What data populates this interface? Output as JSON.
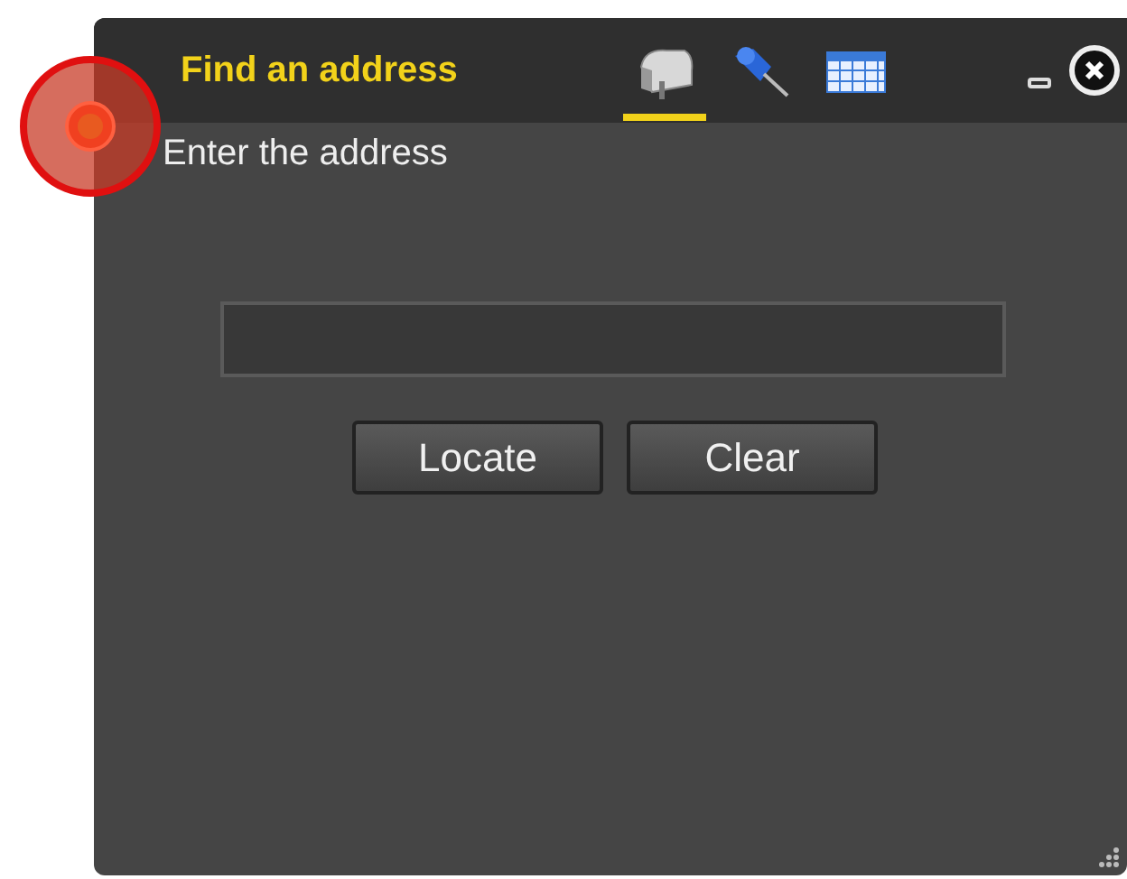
{
  "panel": {
    "title": "Find an address",
    "tabs": [
      {
        "kind": "mailbox",
        "selected": true
      },
      {
        "kind": "pushpin",
        "selected": false
      },
      {
        "kind": "table",
        "selected": false
      }
    ],
    "prompt": "Enter the address",
    "buttons": [
      "Locate",
      "Clear"
    ]
  }
}
